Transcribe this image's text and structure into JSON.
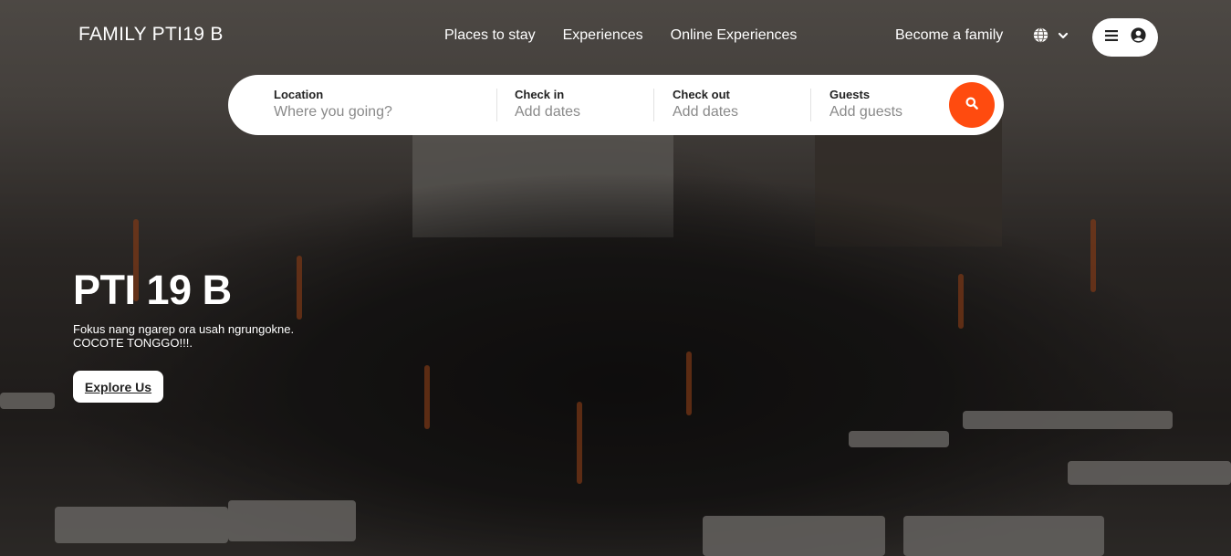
{
  "brand": "FAMILY PTI19 B",
  "nav": {
    "places": "Places to stay",
    "experiences": "Experiences",
    "online": "Online Experiences"
  },
  "host_link": "Become a family",
  "icons": {
    "language": "globe-icon",
    "language_toggle": "chevron-down-icon",
    "menu": "hamburger-menu-icon",
    "account": "user-circle-icon",
    "search": "search-icon"
  },
  "search": {
    "location": {
      "label": "Location",
      "placeholder": "Where you going?"
    },
    "checkin": {
      "label": "Check in",
      "placeholder": "Add dates"
    },
    "checkout": {
      "label": "Check out",
      "placeholder": "Add dates"
    },
    "guests": {
      "label": "Guests",
      "placeholder": "Add guests"
    }
  },
  "hero": {
    "title": "PTI 19 B",
    "subtitle_line1": "Fokus nang ngarep ora usah ngrungokne.",
    "subtitle_line2": "COCOTE TONGGO!!!.",
    "cta": "Explore Us"
  },
  "colors": {
    "accent": "#ff4b0f",
    "text_light": "#ffffff",
    "placeholder": "#8a8a8a"
  }
}
